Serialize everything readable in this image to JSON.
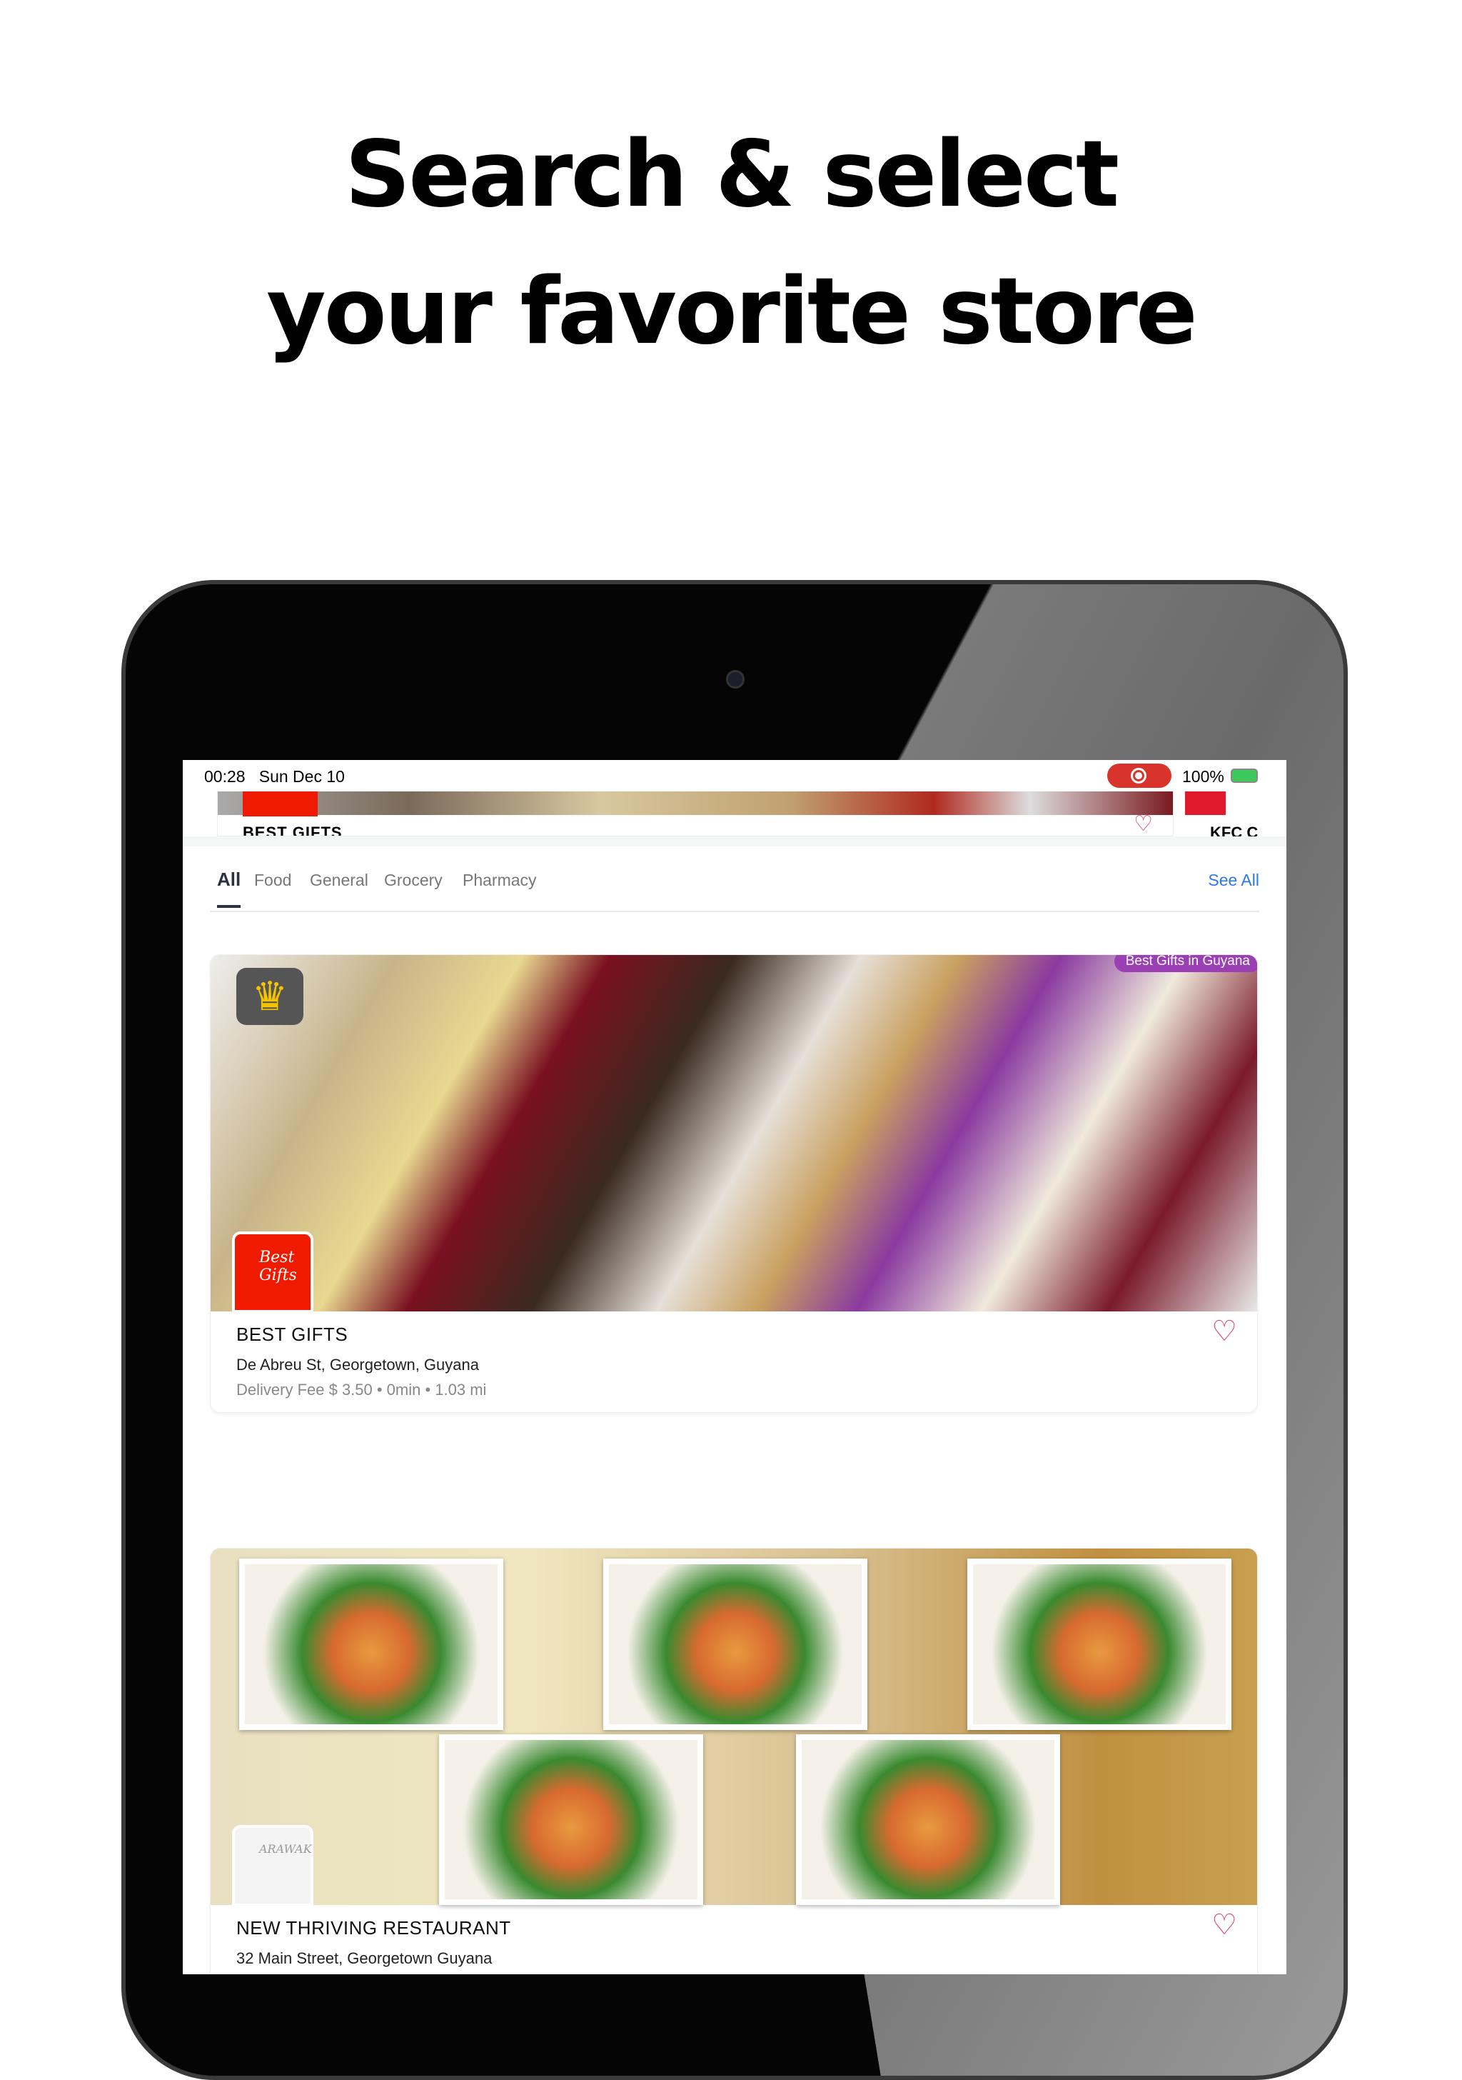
{
  "headline": {
    "line1": "Search & select",
    "line2": "your favorite store"
  },
  "status_bar": {
    "time": "00:28",
    "date": "Sun Dec 10",
    "battery": "100%"
  },
  "top_strip": {
    "store1": "BEST GIFTS",
    "store2": "KFC C"
  },
  "tabs": [
    {
      "label": "All",
      "active": true
    },
    {
      "label": "Food"
    },
    {
      "label": "General"
    },
    {
      "label": "Grocery"
    },
    {
      "label": "Pharmacy"
    }
  ],
  "see_all": "See All",
  "stores": [
    {
      "name": "BEST GIFTS",
      "address": "De Abreu St, Georgetown, Guyana",
      "meta": "Delivery Fee $ 3.50 • 0min • 1.03 mi",
      "badge": "Best Gifts in Guyana",
      "logo_text": "Best Gifts",
      "featured": true
    },
    {
      "name": "NEW THRIVING RESTAURANT",
      "address": "32 Main Street, Georgetown Guyana",
      "logo_text": "ARAWAK"
    }
  ],
  "colors": {
    "accent": "#2d7be0",
    "badge": "#9b3fb5",
    "heart": "#e0335a",
    "record": "#d9342b"
  }
}
